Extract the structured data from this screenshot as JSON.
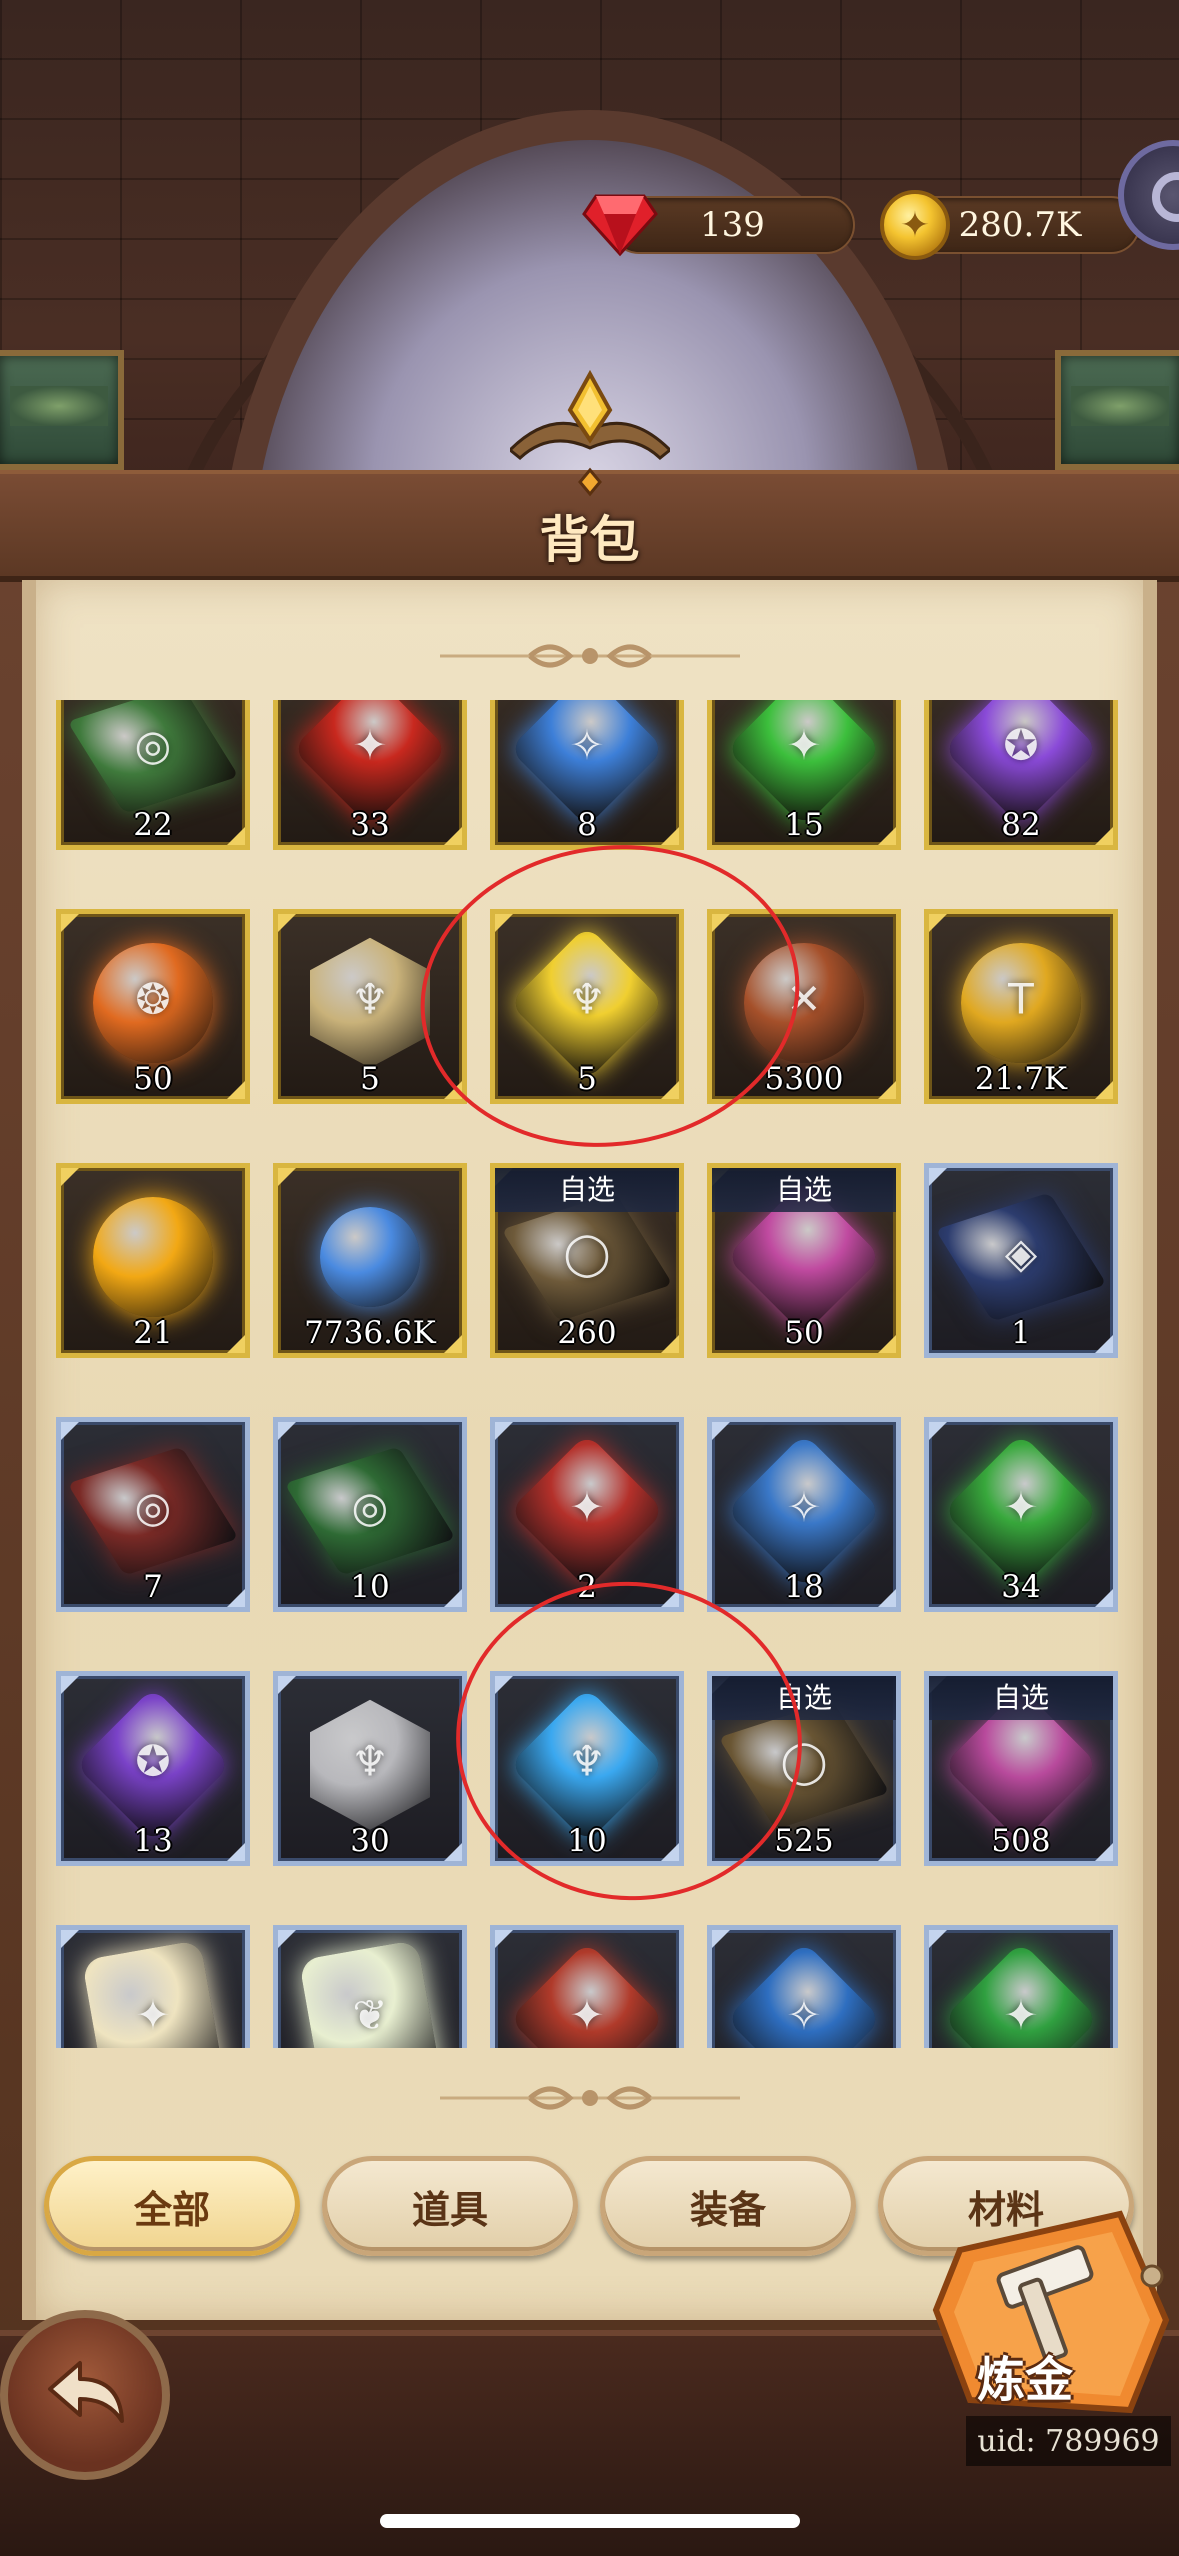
{
  "currency": {
    "gems": "139",
    "gold": "280.7K"
  },
  "title": "背包",
  "items": [
    {
      "qty": "22",
      "badge": "",
      "frame": "gold",
      "shape": "book",
      "color": "#3f7a3c",
      "glyph": "◎",
      "icon": "green-book-icon"
    },
    {
      "qty": "33",
      "badge": "",
      "frame": "gold",
      "shape": "cube",
      "color": "#c8281e",
      "glyph": "✦",
      "icon": "red-crystal-icon"
    },
    {
      "qty": "8",
      "badge": "",
      "frame": "gold",
      "shape": "cube",
      "color": "#3d7fd8",
      "glyph": "✧",
      "icon": "blue-crystal-icon"
    },
    {
      "qty": "15",
      "badge": "",
      "frame": "gold",
      "shape": "cube",
      "color": "#3cbf3c",
      "glyph": "✦",
      "icon": "green-crystal-icon"
    },
    {
      "qty": "82",
      "badge": "",
      "frame": "gold",
      "shape": "cube",
      "color": "#8a4ad8",
      "glyph": "✪",
      "icon": "purple-crystal-icon"
    },
    {
      "qty": "50",
      "badge": "",
      "frame": "gold",
      "shape": "round",
      "color": "#e06a20",
      "glyph": "❂",
      "icon": "flame-orb-icon"
    },
    {
      "qty": "5",
      "badge": "",
      "frame": "gold",
      "shape": "hex",
      "color": "#c9b27a",
      "glyph": "♆",
      "icon": "grail-token-icon"
    },
    {
      "qty": "5",
      "badge": "",
      "frame": "gold",
      "shape": "cube",
      "color": "#f0cf30",
      "glyph": "♆",
      "icon": "golden-grail-shard-icon"
    },
    {
      "qty": "5300",
      "badge": "",
      "frame": "gold",
      "shape": "round",
      "color": "#a5502a",
      "glyph": "✕",
      "icon": "bronze-coin-icon"
    },
    {
      "qty": "21.7K",
      "badge": "",
      "frame": "gold",
      "shape": "round",
      "color": "#e0a820",
      "glyph": "T",
      "icon": "hammer-coin-icon"
    },
    {
      "qty": "21",
      "badge": "",
      "frame": "gold",
      "shape": "round",
      "color": "#f2a814",
      "glyph": "",
      "icon": "gold-nugget-icon"
    },
    {
      "qty": "7736.6K",
      "badge": "",
      "frame": "gold",
      "shape": "bottle",
      "color": "#4a8ae0",
      "glyph": "",
      "icon": "potion-icon"
    },
    {
      "qty": "260",
      "badge": "自选",
      "frame": "gold",
      "shape": "book",
      "color": "#6e5a3a",
      "glyph": "◯",
      "icon": "select-book-icon"
    },
    {
      "qty": "50",
      "badge": "自选",
      "frame": "gold",
      "shape": "cube",
      "color": "#c04aa0",
      "glyph": "",
      "icon": "rainbow-crystal-icon"
    },
    {
      "qty": "1",
      "badge": "",
      "frame": "blue",
      "shape": "book",
      "color": "#2c3c6e",
      "glyph": "◈",
      "icon": "blue-book-icon"
    },
    {
      "qty": "7",
      "badge": "",
      "frame": "blue",
      "shape": "book",
      "color": "#7a2a26",
      "glyph": "◎",
      "icon": "red-book-icon"
    },
    {
      "qty": "10",
      "badge": "",
      "frame": "blue",
      "shape": "book",
      "color": "#2e6a34",
      "glyph": "◎",
      "icon": "green-book-icon"
    },
    {
      "qty": "2",
      "badge": "",
      "frame": "blue",
      "shape": "cube",
      "color": "#b4302a",
      "glyph": "✦",
      "icon": "red-crystal-icon"
    },
    {
      "qty": "18",
      "badge": "",
      "frame": "blue",
      "shape": "cube",
      "color": "#3a78c8",
      "glyph": "✧",
      "icon": "blue-crystal-icon"
    },
    {
      "qty": "34",
      "badge": "",
      "frame": "blue",
      "shape": "cube",
      "color": "#38a83c",
      "glyph": "✦",
      "icon": "green-crystal-icon"
    },
    {
      "qty": "13",
      "badge": "",
      "frame": "blue",
      "shape": "cube",
      "color": "#7a42c8",
      "glyph": "✪",
      "icon": "purple-crystal-icon"
    },
    {
      "qty": "30",
      "badge": "",
      "frame": "blue",
      "shape": "hex",
      "color": "#b8b8bc",
      "glyph": "♆",
      "icon": "silver-grail-token-icon"
    },
    {
      "qty": "10",
      "badge": "",
      "frame": "blue",
      "shape": "cube",
      "color": "#3aa8f0",
      "glyph": "♆",
      "icon": "blue-grail-shard-icon"
    },
    {
      "qty": "525",
      "badge": "自选",
      "frame": "blue",
      "shape": "book",
      "color": "#6a5634",
      "glyph": "◯",
      "icon": "select-book-icon"
    },
    {
      "qty": "508",
      "badge": "自选",
      "frame": "blue",
      "shape": "cube",
      "color": "#b84a9c",
      "glyph": "",
      "icon": "rainbow-crystal-icon"
    },
    {
      "qty": "",
      "badge": "",
      "frame": "blue",
      "shape": "scroll",
      "color": "#efe4c0",
      "glyph": "✦",
      "icon": "scroll-icon"
    },
    {
      "qty": "",
      "badge": "",
      "frame": "blue",
      "shape": "scroll",
      "color": "#e8efd0",
      "glyph": "❦",
      "icon": "green-scroll-icon"
    },
    {
      "qty": "",
      "badge": "",
      "frame": "blue",
      "shape": "cube",
      "color": "#b03a2a",
      "glyph": "✦",
      "icon": "red-crystal-icon"
    },
    {
      "qty": "",
      "badge": "",
      "frame": "blue",
      "shape": "cube",
      "color": "#2e6ec0",
      "glyph": "✧",
      "icon": "blue-crystal-icon"
    },
    {
      "qty": "",
      "badge": "",
      "frame": "blue",
      "shape": "cube",
      "color": "#30a040",
      "glyph": "✦",
      "icon": "green-crystal-icon"
    }
  ],
  "tabs": [
    {
      "label": "全部",
      "active": true
    },
    {
      "label": "道具",
      "active": false
    },
    {
      "label": "装备",
      "active": false
    },
    {
      "label": "材料",
      "active": false
    }
  ],
  "alchemy_label": "炼金",
  "uid": "uid: 789969"
}
